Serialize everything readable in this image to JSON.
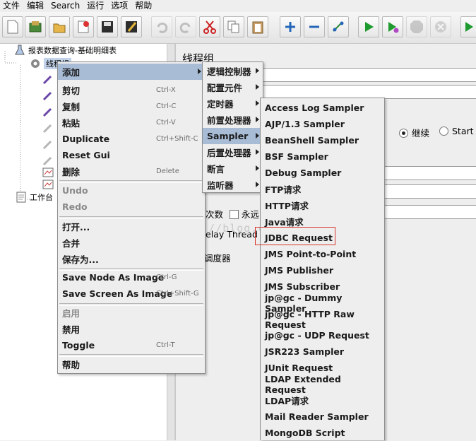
{
  "menubar": [
    "文件",
    "编辑",
    "Search",
    "运行",
    "选项",
    "帮助"
  ],
  "toolbar": {
    "buttons": [
      "new-icon",
      "templates-icon",
      "open-icon",
      "close-icon",
      "save-icon",
      "save-as-icon",
      "undo-icon",
      "redo-icon",
      "cut-icon",
      "copy-icon",
      "paste-icon",
      "expand-icon",
      "collapse-icon",
      "toggle-icon",
      "start-icon",
      "start-no-pause-icon",
      "stop-icon",
      "shutdown-icon",
      "remote-start-icon"
    ]
  },
  "tree": {
    "test_plan": "报表数据查询-基础明细表",
    "thread_group": "线程组",
    "workbench": "工作台"
  },
  "right": {
    "title": "线程组",
    "continue_label": "继续",
    "start_next_label": "Start N",
    "loop_label": "次数",
    "forever_label": "永远",
    "delay_label": "elay Thread c",
    "scheduler_label": "调度器",
    "watermark": "http://blog.csdn.net/"
  },
  "context_menu": {
    "items": [
      {
        "label": "添加",
        "shortcut": "",
        "submenu": true,
        "enabled": true
      },
      {
        "label": "剪切",
        "shortcut": "Ctrl-X",
        "enabled": true
      },
      {
        "label": "复制",
        "shortcut": "Ctrl-C",
        "enabled": true
      },
      {
        "label": "粘贴",
        "shortcut": "Ctrl-V",
        "enabled": true
      },
      {
        "label": "Duplicate",
        "shortcut": "Ctrl+Shift-C",
        "enabled": true
      },
      {
        "label": "Reset Gui",
        "shortcut": "",
        "enabled": true
      },
      {
        "label": "删除",
        "shortcut": "Delete",
        "enabled": true
      },
      {
        "label": "Undo",
        "shortcut": "",
        "enabled": false
      },
      {
        "label": "Redo",
        "shortcut": "",
        "enabled": false
      },
      {
        "label": "打开...",
        "shortcut": "",
        "enabled": true
      },
      {
        "label": "合并",
        "shortcut": "",
        "enabled": true
      },
      {
        "label": "保存为...",
        "shortcut": "",
        "enabled": true
      },
      {
        "label": "Save Node As Image",
        "shortcut": "Ctrl-G",
        "enabled": true
      },
      {
        "label": "Save Screen As Image",
        "shortcut": "Ctrl+Shift-G",
        "enabled": true
      },
      {
        "label": "启用",
        "shortcut": "",
        "enabled": false
      },
      {
        "label": "禁用",
        "shortcut": "",
        "enabled": true
      },
      {
        "label": "Toggle",
        "shortcut": "Ctrl-T",
        "enabled": true
      },
      {
        "label": "帮助",
        "shortcut": "",
        "enabled": true
      }
    ]
  },
  "add_menu": {
    "items": [
      "逻辑控制器",
      "配置元件",
      "定时器",
      "前置处理器",
      "Sampler",
      "后置处理器",
      "断言",
      "监听器"
    ],
    "selected": "Sampler"
  },
  "sampler_menu": {
    "items": [
      "Access Log Sampler",
      "AJP/1.3 Sampler",
      "BeanShell Sampler",
      "BSF Sampler",
      "Debug Sampler",
      "FTP请求",
      "HTTP请求",
      "Java请求",
      "JDBC Request",
      "JMS Point-to-Point",
      "JMS Publisher",
      "JMS Subscriber",
      "jp@gc - Dummy Sampler",
      "jp@gc - HTTP Raw Request",
      "jp@gc - UDP Request",
      "JSR223 Sampler",
      "JUnit Request",
      "LDAP Extended Request",
      "LDAP请求",
      "Mail Reader Sampler",
      "MongoDB Script"
    ],
    "highlighted": "JDBC Request"
  },
  "colors": {
    "highlight": "#a8bcd6",
    "menu_bg": "#eeeeee",
    "annotation": "#d9352b"
  }
}
